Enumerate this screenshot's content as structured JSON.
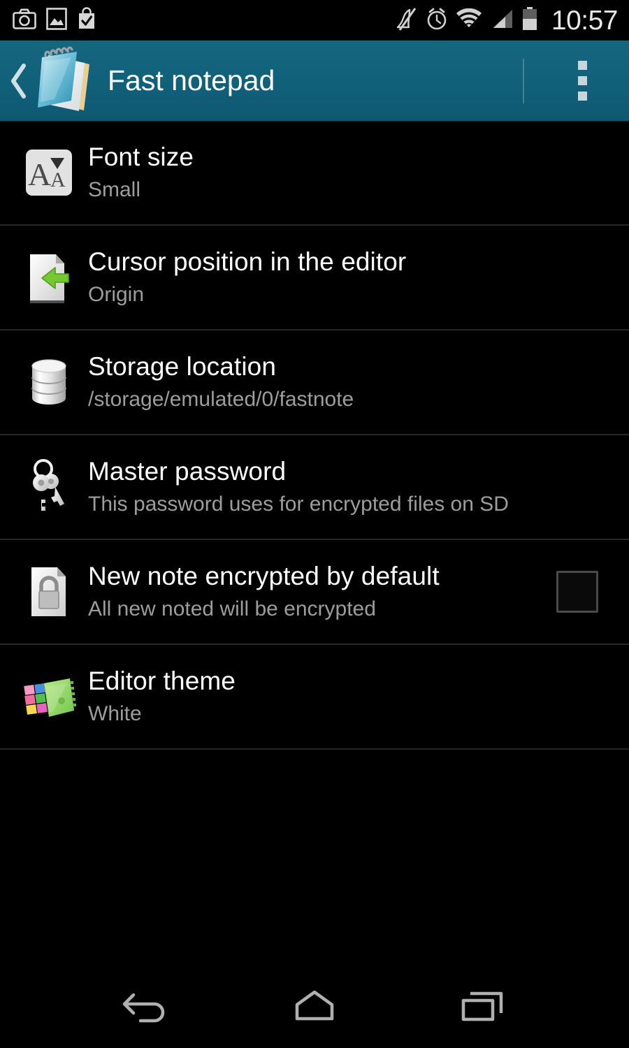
{
  "status_bar": {
    "time": "10:57",
    "left_icons": [
      "camera-icon",
      "gallery-icon",
      "play-store-bag-icon"
    ],
    "right_icons": [
      "mute-icon",
      "alarm-icon",
      "wifi-icon",
      "signal-icon",
      "battery-icon"
    ]
  },
  "action_bar": {
    "title": "Fast notepad",
    "back_icon": "back-chevron-icon",
    "app_icon": "notepad-app-icon",
    "overflow_icon": "overflow-menu-icon",
    "background_color": "#11607a"
  },
  "settings": {
    "rows": [
      {
        "title": "Font size",
        "summary": "Small",
        "icon": "font-size-icon",
        "widget": "none"
      },
      {
        "title": "Cursor position in the editor",
        "summary": "Origin",
        "icon": "cursor-position-icon",
        "widget": "none"
      },
      {
        "title": "Storage location",
        "summary": "/storage/emulated/0/fastnote",
        "icon": "database-icon",
        "widget": "none"
      },
      {
        "title": "Master password",
        "summary": "This password uses for encrypted files on SD",
        "icon": "keys-icon",
        "widget": "none"
      },
      {
        "title": "New note encrypted by default",
        "summary": "All new noted will be encrypted",
        "icon": "encrypted-document-icon",
        "widget": "checkbox",
        "checked": false
      },
      {
        "title": "Editor theme",
        "summary": "White",
        "icon": "editor-theme-icon",
        "widget": "none"
      }
    ]
  },
  "nav_bar": {
    "back_label": "Back",
    "home_label": "Home",
    "recents_label": "Recent apps"
  }
}
